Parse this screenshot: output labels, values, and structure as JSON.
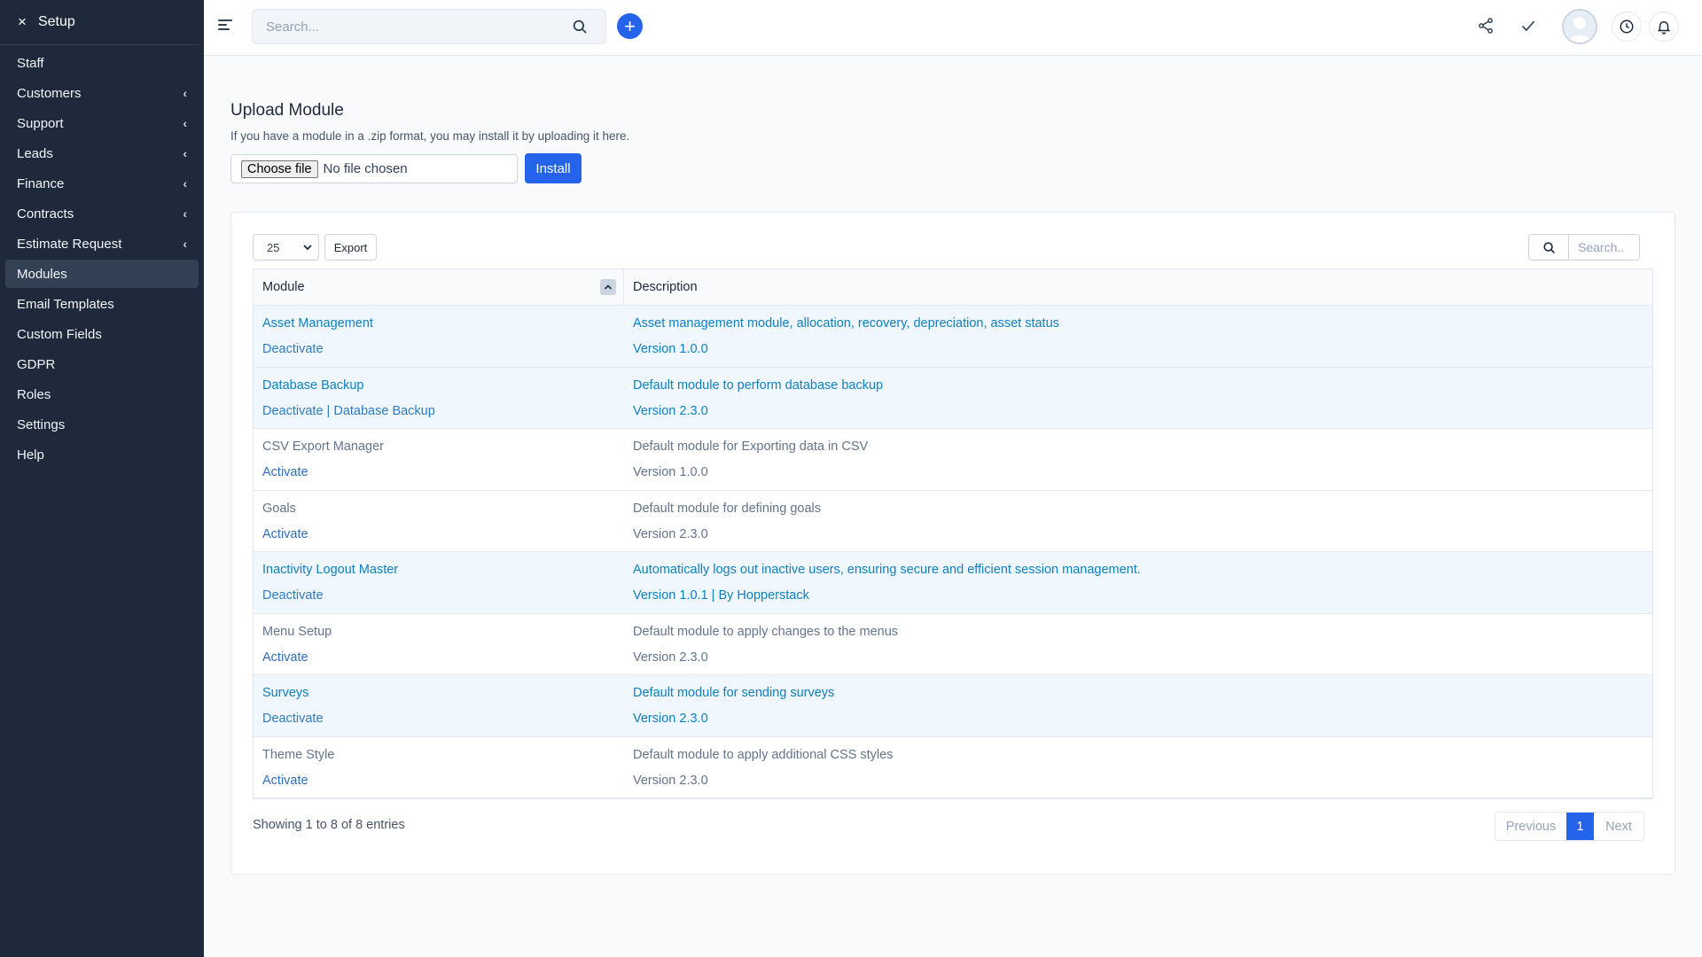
{
  "sidebar": {
    "title": "Setup",
    "close_icon": "×",
    "items": [
      {
        "label": "Staff",
        "chevron": ""
      },
      {
        "label": "Customers",
        "chevron": "‹"
      },
      {
        "label": "Support",
        "chevron": "‹"
      },
      {
        "label": "Leads",
        "chevron": "‹"
      },
      {
        "label": "Finance",
        "chevron": "‹"
      },
      {
        "label": "Contracts",
        "chevron": "‹"
      },
      {
        "label": "Estimate Request",
        "chevron": "‹"
      },
      {
        "label": "Modules",
        "chevron": "",
        "active": true
      },
      {
        "label": "Email Templates",
        "chevron": ""
      },
      {
        "label": "Custom Fields",
        "chevron": ""
      },
      {
        "label": "GDPR",
        "chevron": ""
      },
      {
        "label": "Roles",
        "chevron": ""
      },
      {
        "label": "Settings",
        "chevron": ""
      },
      {
        "label": "Help",
        "chevron": ""
      }
    ]
  },
  "topbar": {
    "search_placeholder": "Search...",
    "plus_label": "+",
    "icons": [
      "share-icon",
      "check-icon",
      "avatar",
      "clock-icon",
      "bell-icon"
    ]
  },
  "upload": {
    "title": "Upload Module",
    "description": "If you have a module in a .zip format, you may install it by uploading it here.",
    "choose_label": "Choose file",
    "file_status": "No file chosen",
    "install_label": "Install"
  },
  "table": {
    "page_length": "25",
    "export_label": "Export",
    "search_placeholder": "Search..",
    "columns": [
      "Module",
      "Description"
    ],
    "rows": [
      {
        "name": "Asset Management",
        "actions": [
          "Deactivate"
        ],
        "description": "Asset management module, allocation, recovery, depreciation, asset status",
        "version": "Version 1.0.0",
        "active": true
      },
      {
        "name": "Database Backup",
        "actions": [
          "Deactivate",
          "Database Backup"
        ],
        "description": "Default module to perform database backup",
        "version": "Version 2.3.0",
        "active": true
      },
      {
        "name": "CSV Export Manager",
        "actions": [
          "Activate"
        ],
        "description": "Default module for Exporting data in CSV",
        "version": "Version 1.0.0",
        "active": false
      },
      {
        "name": "Goals",
        "actions": [
          "Activate"
        ],
        "description": "Default module for defining goals",
        "version": "Version 2.3.0",
        "active": false
      },
      {
        "name": "Inactivity Logout Master",
        "actions": [
          "Deactivate"
        ],
        "description": "Automatically logs out inactive users, ensuring secure and efficient session management.",
        "version": "Version 1.0.1 | By Hopperstack",
        "active": true
      },
      {
        "name": "Menu Setup",
        "actions": [
          "Activate"
        ],
        "description": "Default module to apply changes to the menus",
        "version": "Version 2.3.0",
        "active": false
      },
      {
        "name": "Surveys",
        "actions": [
          "Deactivate"
        ],
        "description": "Default module for sending surveys",
        "version": "Version 2.3.0",
        "active": true
      },
      {
        "name": "Theme Style",
        "actions": [
          "Activate"
        ],
        "description": "Default module to apply additional CSS styles",
        "version": "Version 2.3.0",
        "active": false
      }
    ],
    "showing_text": "Showing 1 to 8 of 8 entries",
    "pagination": {
      "previous": "Previous",
      "current": "1",
      "next": "Next"
    }
  },
  "colors": {
    "sidebar_bg": "#1e293b",
    "accent": "#2563eb",
    "active_row_bg": "#f0f7ff",
    "active_text": "#0e7fc0"
  }
}
